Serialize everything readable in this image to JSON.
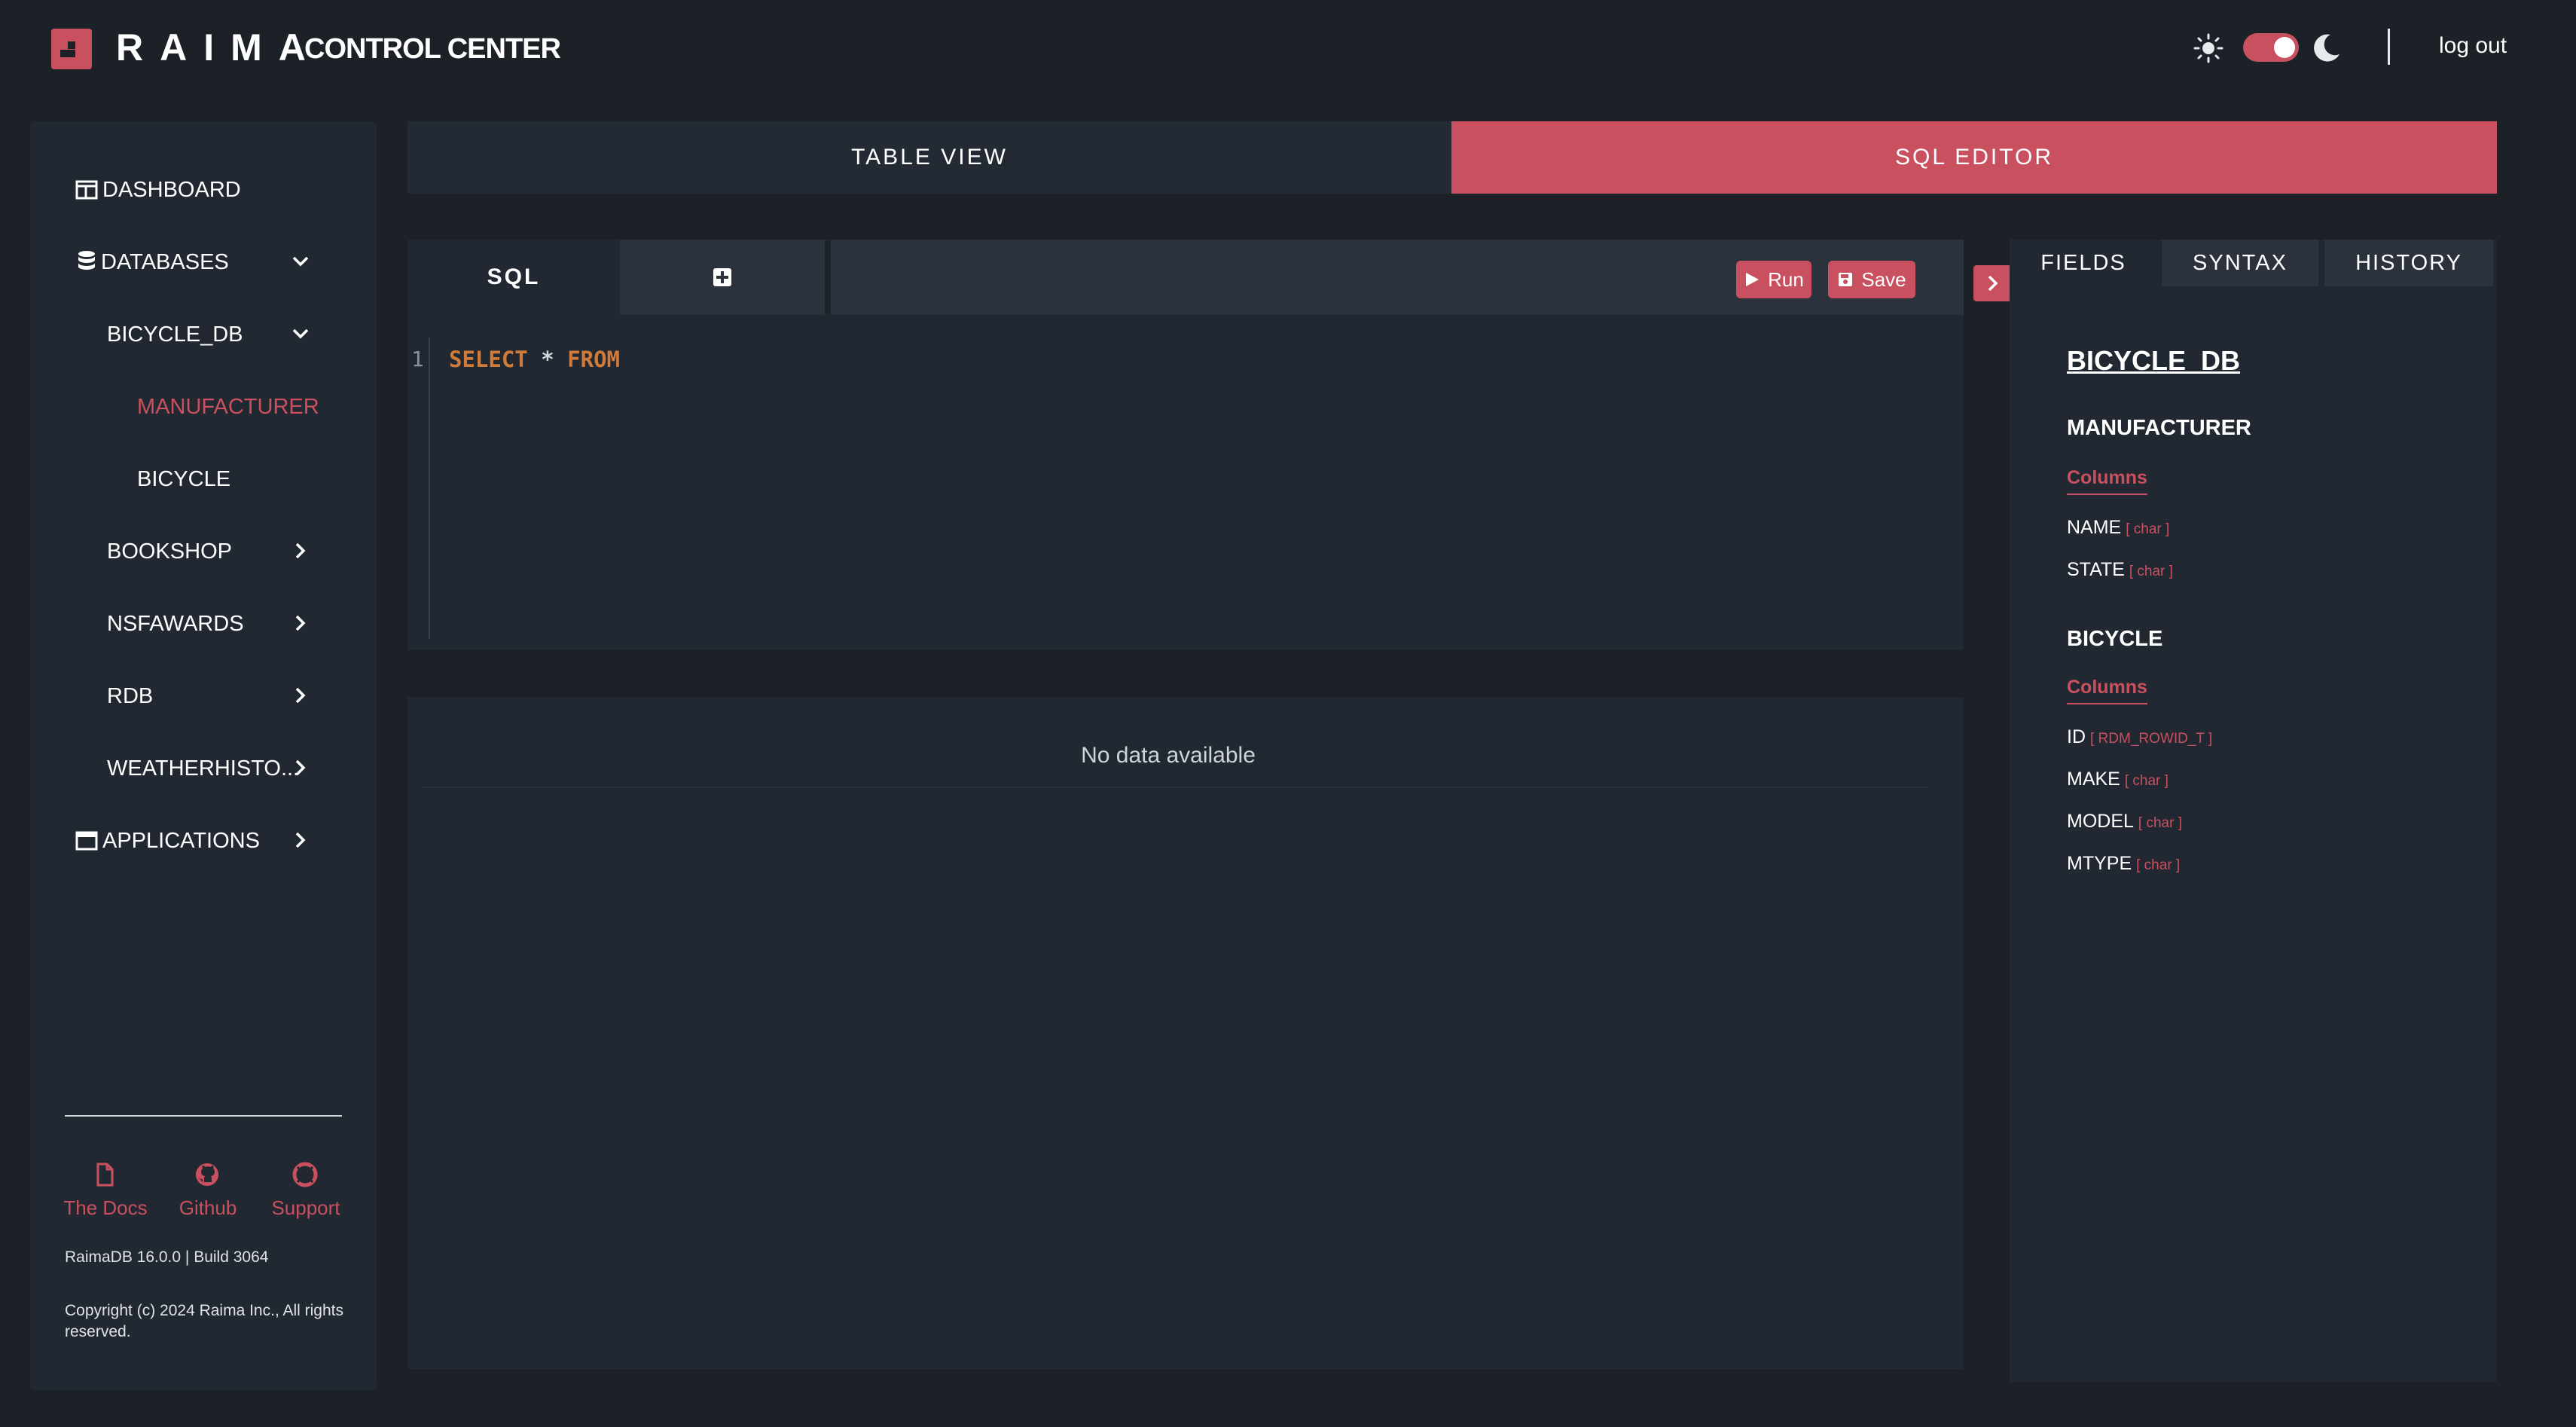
{
  "header": {
    "brand": "RAIMA",
    "brand_sub": "CONTROL CENTER",
    "logout": "log out",
    "accent_color": "#c9505e"
  },
  "sidebar": {
    "items": [
      {
        "label": "DASHBOARD",
        "icon": "dashboard-icon"
      },
      {
        "label": "DATABASES",
        "icon": "database-icon",
        "expanded": true
      },
      {
        "label": "BICYCLE_DB",
        "expanded": true
      },
      {
        "label": "MANUFACTURER",
        "active": true
      },
      {
        "label": "BICYCLE"
      },
      {
        "label": "BOOKSHOP"
      },
      {
        "label": "NSFAWARDS"
      },
      {
        "label": "RDB"
      },
      {
        "label": "WEATHERHISTO..."
      },
      {
        "label": "APPLICATIONS",
        "icon": "applications-icon"
      }
    ],
    "footer_links": [
      "The Docs",
      "Github",
      "Support"
    ],
    "build": "RaimaDB 16.0.0 | Build 3064",
    "copyright": "Copyright (c) 2024 Raima Inc., All rights reserved."
  },
  "main": {
    "tabs": [
      "TABLE VIEW",
      "SQL EDITOR"
    ],
    "active_tab": "SQL EDITOR",
    "editor": {
      "tab_label": "SQL",
      "run_label": "Run",
      "save_label": "Save",
      "line_number": "1",
      "code_keyword1": "SELECT",
      "code_operator": "*",
      "code_keyword2": "FROM"
    },
    "results": {
      "empty_text": "No data available"
    }
  },
  "right_panel": {
    "tabs": [
      "FIELDS",
      "SYNTAX",
      "HISTORY"
    ],
    "active_tab": "FIELDS",
    "db_name": "BICYCLE_DB",
    "columns_label": "Columns",
    "tables": [
      {
        "name": "MANUFACTURER",
        "columns": [
          {
            "name": "NAME",
            "type": "[ char ]"
          },
          {
            "name": "STATE",
            "type": "[ char ]"
          }
        ]
      },
      {
        "name": "BICYCLE",
        "columns": [
          {
            "name": "ID",
            "type": "[ RDM_ROWID_T ]"
          },
          {
            "name": "MAKE",
            "type": "[ char ]"
          },
          {
            "name": "MODEL",
            "type": "[ char ]"
          },
          {
            "name": "MTYPE",
            "type": "[ char ]"
          }
        ]
      }
    ]
  }
}
